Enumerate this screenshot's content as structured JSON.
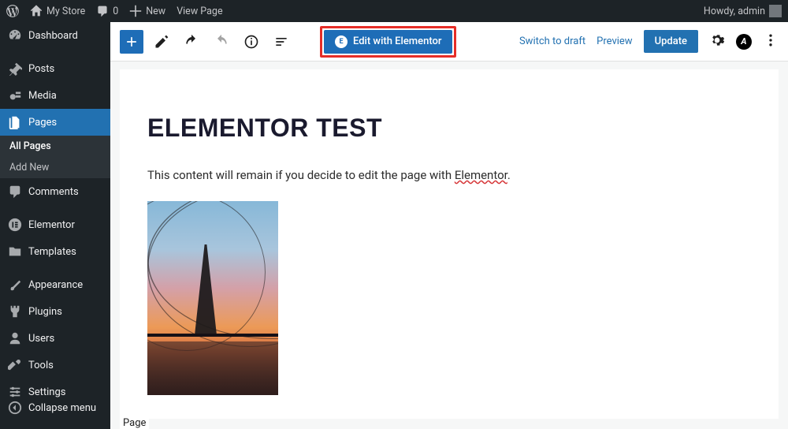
{
  "adminbar": {
    "site_name": "My Store",
    "comments_count": "0",
    "new_label": "New",
    "view_page": "View Page",
    "howdy": "Howdy, admin"
  },
  "sidebar": {
    "dashboard": "Dashboard",
    "posts": "Posts",
    "media": "Media",
    "pages": "Pages",
    "all_pages": "All Pages",
    "add_new": "Add New",
    "comments": "Comments",
    "elementor": "Elementor",
    "templates": "Templates",
    "appearance": "Appearance",
    "plugins": "Plugins",
    "users": "Users",
    "tools": "Tools",
    "settings": "Settings",
    "collapse": "Collapse menu"
  },
  "toolbar": {
    "elementor_btn": "Edit with Elementor",
    "switch_draft": "Switch to draft",
    "preview": "Preview",
    "update": "Update"
  },
  "page": {
    "title": "ELEMENTOR TEST",
    "content_before": "This content will remain if you decide to edit the page with ",
    "content_link": "Elementor",
    "content_after": "."
  },
  "footer": {
    "template_label": "Page"
  }
}
